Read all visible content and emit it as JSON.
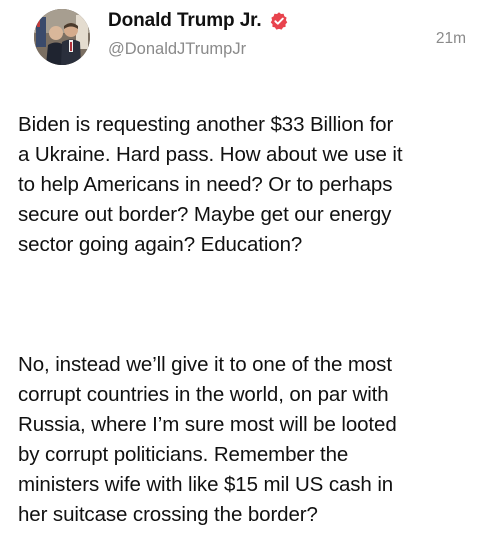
{
  "author": {
    "display_name": "Donald Trump Jr.",
    "handle": "@DonaldJTrumpJr",
    "verified_icon": "verified-check-icon",
    "verified_color": "#e8434d",
    "avatar": "profile-photo"
  },
  "post": {
    "timestamp": "21m",
    "paragraph_1": "Biden is requesting another $33 Billion for\na Ukraine. Hard pass. How about we use it\nto help Americans in need? Or to perhaps\nsecure out border? Maybe get our energy\nsector going again? Education?",
    "paragraph_2": "No, instead we’ll give it to one of the most\ncorrupt countries in the world, on par with\nRussia, where I’m sure most will be looted\nby corrupt politicians. Remember the\nministers wife with like $15 mil US cash in\nher suitcase crossing the border?"
  }
}
